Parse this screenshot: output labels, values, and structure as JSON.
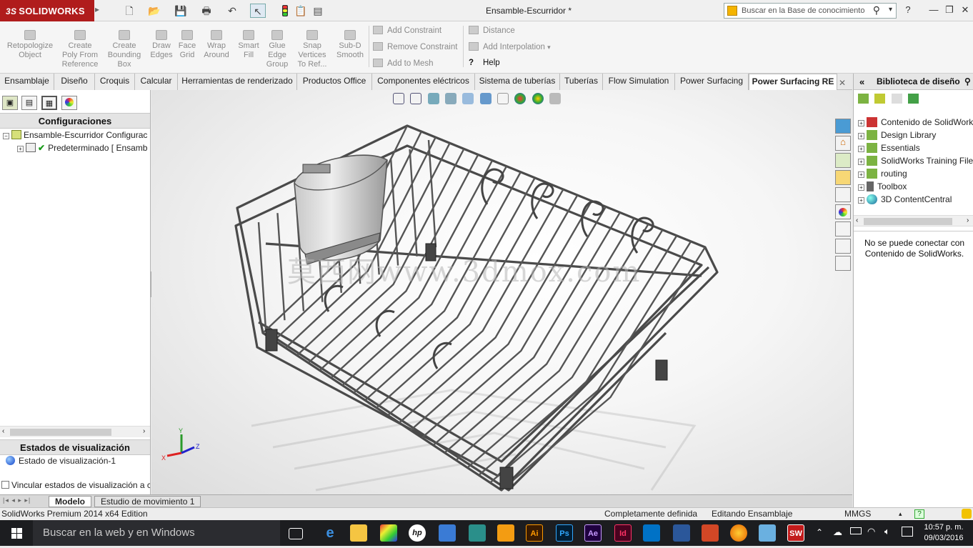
{
  "app": {
    "logo_text": "SOLIDWORKS",
    "logo_prefix": "3S",
    "document_title": "Ensamble-Escurridor *"
  },
  "search": {
    "placeholder": "Buscar en la Base de conocimiento"
  },
  "window_controls": {
    "help": "?",
    "minimize": "—",
    "restore": "❐",
    "close": "✕"
  },
  "toolbar": {
    "tools": [
      {
        "label": "Retopologize\nObject"
      },
      {
        "label": "Create\nPoly From\nReference"
      },
      {
        "label": "Create\nBounding\nBox"
      },
      {
        "label": "Draw\nEdges"
      },
      {
        "label": "Face\nGrid"
      },
      {
        "label": "Wrap\nAround"
      },
      {
        "label": "Smart\nFill"
      },
      {
        "label": "Glue\nEdge\nGroup"
      },
      {
        "label": "Snap\nVertices\nTo Ref..."
      },
      {
        "label": "Sub-D\nSmooth"
      }
    ],
    "constraint_group": [
      "Add Constraint",
      "Remove Constraint",
      "Add to Mesh"
    ],
    "distance_group": [
      "Distance",
      "Add Interpolation",
      "Help"
    ]
  },
  "tabs": [
    "Ensamblaje",
    "Diseño",
    "Croquis",
    "Calcular",
    "Herramientas de renderizado",
    "Productos Office",
    "Componentes eléctricos",
    "Sistema de tuberías",
    "Tuberías",
    "Flow Simulation",
    "Power Surfacing",
    "Power Surfacing RE"
  ],
  "active_tab": "Power Surfacing RE",
  "left_panel": {
    "config_header": "Configuraciones",
    "tree": [
      {
        "label": "Ensamble-Escurridor Configurac"
      },
      {
        "label": "Predeterminado [ Ensamb"
      }
    ],
    "display_header": "Estados de visualización",
    "display_state": "Estado de visualización-1",
    "link_checkbox": "Vincular estados de visualización a co"
  },
  "bottom_tabs": [
    "Modelo",
    "Estudio de movimiento 1"
  ],
  "status_bar": {
    "edition": "SolidWorks Premium 2014 x64 Edition",
    "definition": "Completamente definida",
    "mode": "Editando Ensamblaje",
    "units": "MMGS",
    "help": "?"
  },
  "viewport": {
    "watermark": "莫西网www.3dmox.com",
    "triad_labels": {
      "x": "X",
      "y": "Y",
      "z": "Z"
    }
  },
  "design_library": {
    "header": "Biblioteca de diseño",
    "items": [
      "Contenido de SolidWorks",
      "Design Library",
      "Essentials",
      "SolidWorks Training Files",
      "routing",
      "Toolbox",
      "3D ContentCentral"
    ],
    "message": "No se puede conectar con Contenido de SolidWorks."
  },
  "taskbar": {
    "search_placeholder": "Buscar en la web y en Windows",
    "apps": [
      "task-view",
      "edge",
      "explorer",
      "pinnacle",
      "hp",
      "rocket",
      "maya",
      "box",
      "Ai",
      "Ps",
      "Ae",
      "Id",
      "outlook",
      "word",
      "powerpoint",
      "firefox",
      "photos",
      "SW"
    ],
    "time": "10:57 p. m.",
    "date": "09/03/2016"
  },
  "colors": {
    "brand": "#b01c1c",
    "tab_active_bg": "#ffffff",
    "taskbar": "#1c1d20"
  }
}
